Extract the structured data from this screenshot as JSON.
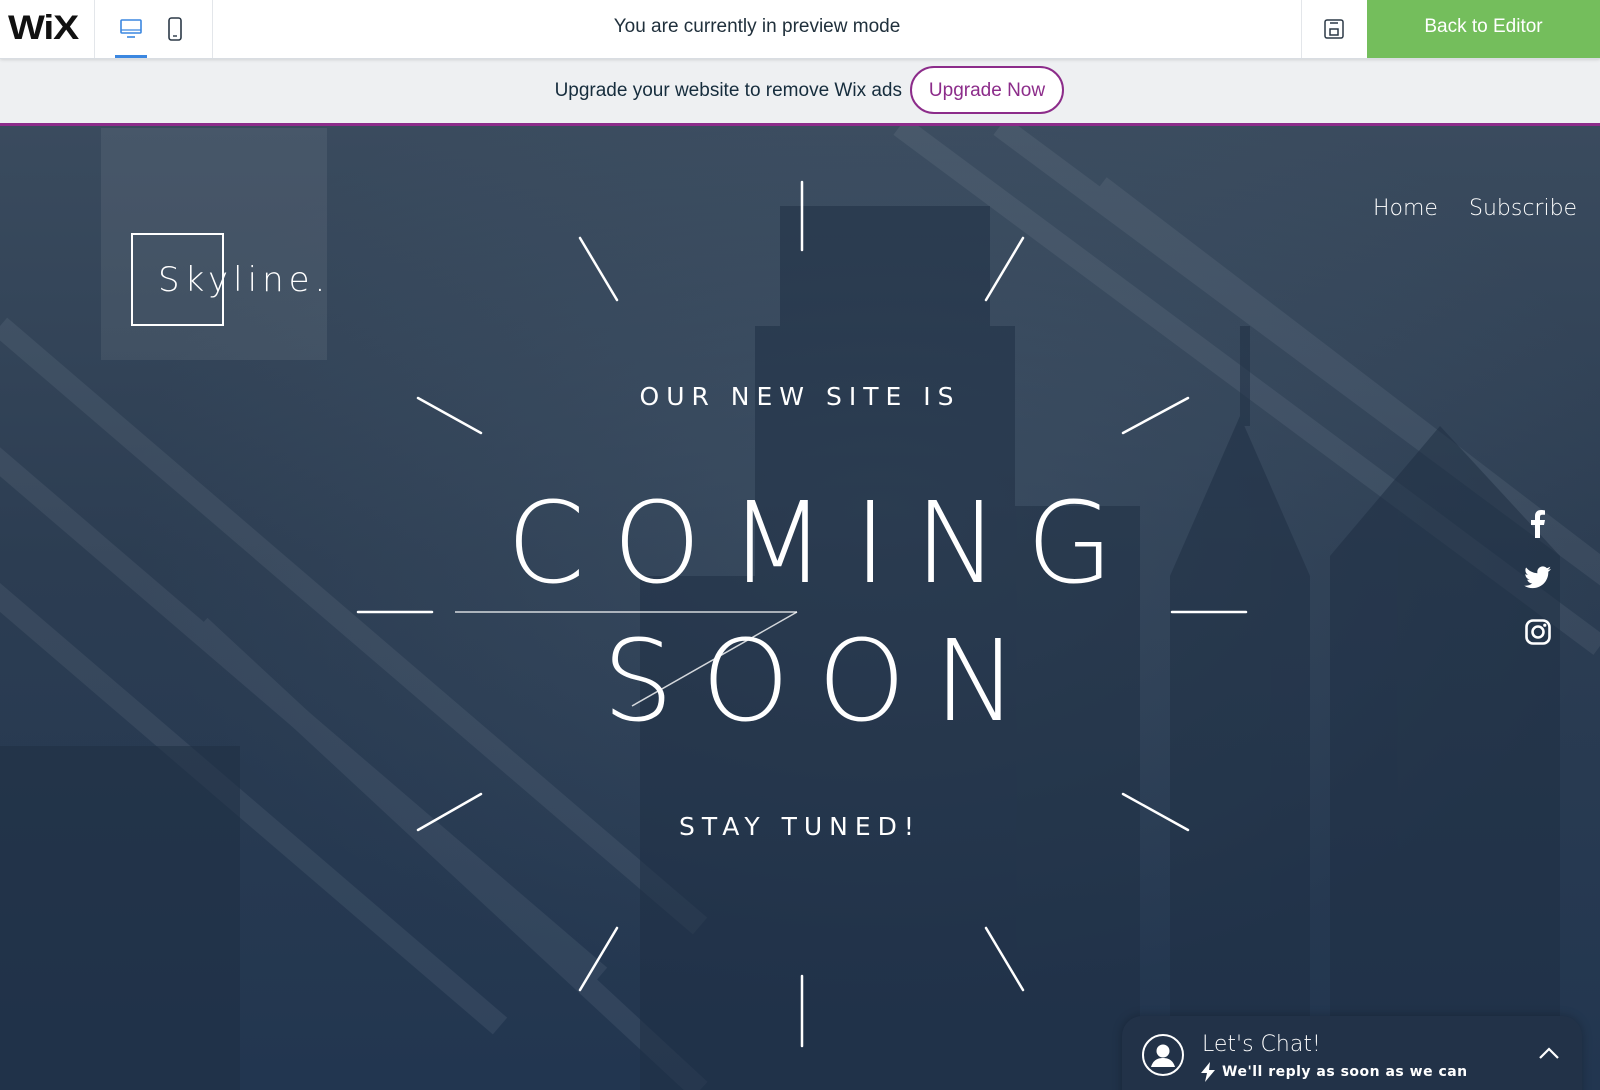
{
  "topbar": {
    "logo": "WiX",
    "preview_message": "You are currently in preview mode",
    "back_label": "Back to Editor",
    "icons": {
      "desktop": "desktop-icon",
      "mobile": "mobile-icon",
      "save": "save-icon"
    }
  },
  "adbar": {
    "message": "Upgrade your website to remove Wix ads",
    "upgrade_label": "Upgrade Now"
  },
  "site": {
    "brand": "Skyline.",
    "nav": [
      {
        "label": "Home"
      },
      {
        "label": "Subscribe"
      }
    ],
    "headline_top": "OUR NEW SITE IS",
    "headline_line1": "COMING",
    "headline_line2": "SOON",
    "headline_bottom": "STAY TUNED!",
    "social": [
      "facebook-icon",
      "twitter-icon",
      "instagram-icon"
    ]
  },
  "chat": {
    "title": "Let's Chat!",
    "subtitle": "We'll reply as soon as we can"
  },
  "colors": {
    "accent_green": "#74be5c",
    "accent_purple": "#8c2c8a",
    "active_blue": "#3b87e0",
    "hero_bg": "#2c3d52"
  }
}
